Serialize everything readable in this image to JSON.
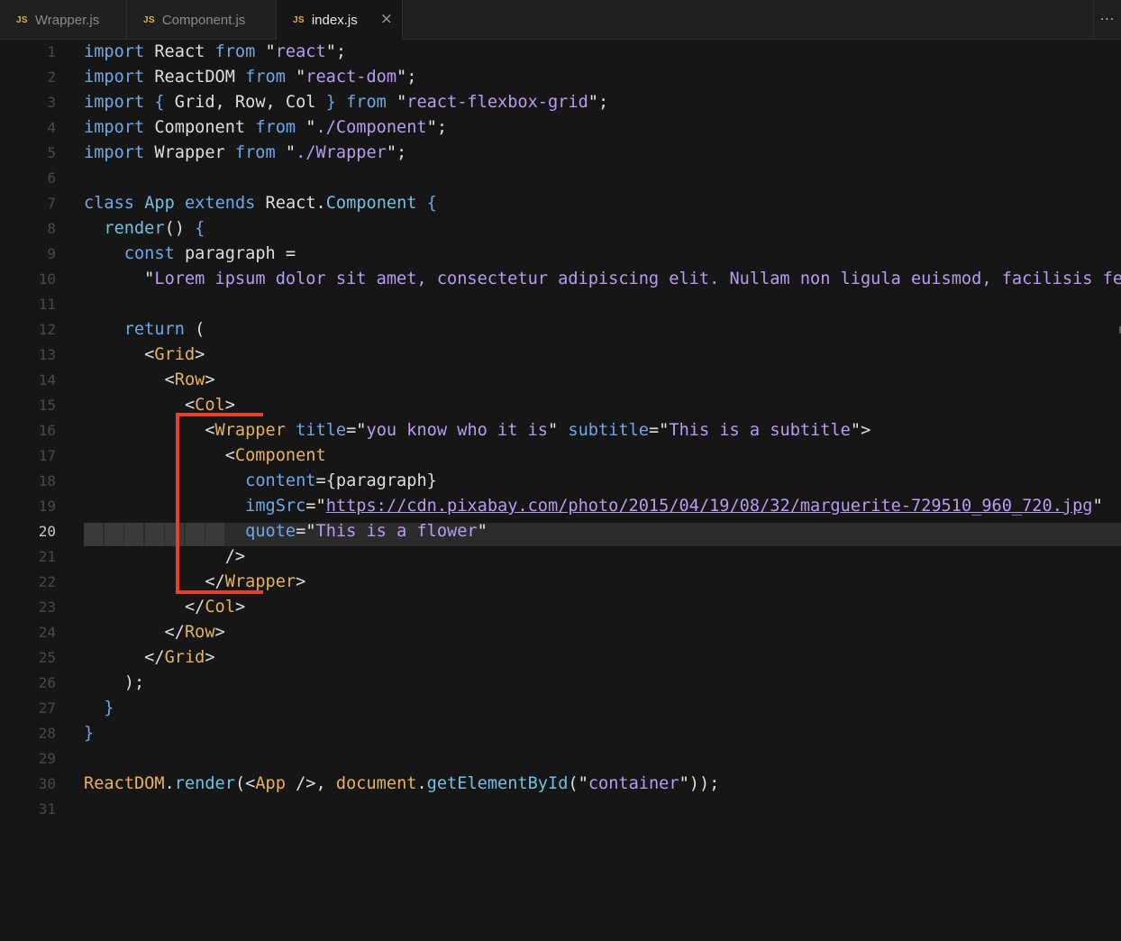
{
  "tabs": [
    {
      "icon": "JS",
      "label": "Wrapper.js"
    },
    {
      "icon": "JS",
      "label": "Component.js"
    },
    {
      "icon": "JS",
      "label": "index.js",
      "close": "×"
    }
  ],
  "more": "···",
  "lines": [
    {
      "n": "1",
      "t": [
        [
          "k",
          "import"
        ],
        [
          "p",
          " React "
        ],
        [
          "k",
          "from"
        ],
        [
          "q",
          " \""
        ],
        [
          "s",
          "react"
        ],
        [
          "q",
          "\""
        ],
        [
          "p",
          ";"
        ]
      ]
    },
    {
      "n": "2",
      "t": [
        [
          "k",
          "import"
        ],
        [
          "p",
          " ReactDOM "
        ],
        [
          "k",
          "from"
        ],
        [
          "q",
          " \""
        ],
        [
          "s",
          "react-dom"
        ],
        [
          "q",
          "\""
        ],
        [
          "p",
          ";"
        ]
      ]
    },
    {
      "n": "3",
      "t": [
        [
          "k",
          "import"
        ],
        [
          "k",
          " { "
        ],
        [
          "p",
          "Grid, Row, Col"
        ],
        [
          "k",
          " } "
        ],
        [
          "k",
          "from"
        ],
        [
          "q",
          " \""
        ],
        [
          "s",
          "react-flexbox-grid"
        ],
        [
          "q",
          "\""
        ],
        [
          "p",
          ";"
        ]
      ]
    },
    {
      "n": "4",
      "t": [
        [
          "k",
          "import"
        ],
        [
          "p",
          " Component "
        ],
        [
          "k",
          "from"
        ],
        [
          "q",
          " \""
        ],
        [
          "s",
          "./Component"
        ],
        [
          "q",
          "\""
        ],
        [
          "p",
          ";"
        ]
      ]
    },
    {
      "n": "5",
      "t": [
        [
          "k",
          "import"
        ],
        [
          "p",
          " Wrapper "
        ],
        [
          "k",
          "from"
        ],
        [
          "q",
          " \""
        ],
        [
          "s",
          "./Wrapper"
        ],
        [
          "q",
          "\""
        ],
        [
          "p",
          ";"
        ]
      ]
    },
    {
      "n": "6",
      "t": []
    },
    {
      "n": "7",
      "t": [
        [
          "k",
          "class"
        ],
        [
          "p",
          " "
        ],
        [
          "f",
          "App"
        ],
        [
          "p",
          " "
        ],
        [
          "k",
          "extends"
        ],
        [
          "p",
          " React."
        ],
        [
          "f",
          "Component"
        ],
        [
          "k",
          " {"
        ]
      ]
    },
    {
      "n": "8",
      "t": [
        [
          "p",
          "  "
        ],
        [
          "f",
          "render"
        ],
        [
          "p",
          "() "
        ],
        [
          "k",
          "{"
        ]
      ]
    },
    {
      "n": "9",
      "t": [
        [
          "p",
          "    "
        ],
        [
          "k",
          "const"
        ],
        [
          "p",
          " paragraph ="
        ]
      ]
    },
    {
      "n": "10",
      "t": [
        [
          "p",
          "      "
        ],
        [
          "q",
          "\""
        ],
        [
          "s",
          "Lorem ipsum dolor sit amet, consectetur adipiscing elit. Nullam non ligula euismod, facilisis fe"
        ]
      ]
    },
    {
      "n": "11",
      "t": []
    },
    {
      "n": "12",
      "t": [
        [
          "p",
          "    "
        ],
        [
          "k",
          "return"
        ],
        [
          "p",
          " ("
        ]
      ]
    },
    {
      "n": "13",
      "t": [
        [
          "p",
          "      <"
        ],
        [
          "t",
          "Grid"
        ],
        [
          "p",
          ">"
        ]
      ]
    },
    {
      "n": "14",
      "t": [
        [
          "p",
          "        <"
        ],
        [
          "t",
          "Row"
        ],
        [
          "p",
          ">"
        ]
      ]
    },
    {
      "n": "15",
      "t": [
        [
          "p",
          "          <"
        ],
        [
          "t",
          "Col"
        ],
        [
          "p",
          ">"
        ]
      ]
    },
    {
      "n": "16",
      "t": [
        [
          "p",
          "            <"
        ],
        [
          "t",
          "Wrapper"
        ],
        [
          "p",
          " "
        ],
        [
          "a",
          "title"
        ],
        [
          "p",
          "="
        ],
        [
          "q",
          "\""
        ],
        [
          "s",
          "you know who it is"
        ],
        [
          "q",
          "\""
        ],
        [
          "p",
          " "
        ],
        [
          "a",
          "subtitle"
        ],
        [
          "p",
          "="
        ],
        [
          "q",
          "\""
        ],
        [
          "s",
          "This is a subtitle"
        ],
        [
          "q",
          "\""
        ],
        [
          "p",
          ">"
        ]
      ]
    },
    {
      "n": "17",
      "t": [
        [
          "p",
          "              <"
        ],
        [
          "t",
          "Component"
        ]
      ]
    },
    {
      "n": "18",
      "t": [
        [
          "p",
          "                "
        ],
        [
          "a",
          "content"
        ],
        [
          "p",
          "={paragraph}"
        ]
      ]
    },
    {
      "n": "19",
      "t": [
        [
          "p",
          "                "
        ],
        [
          "a",
          "imgSrc"
        ],
        [
          "p",
          "="
        ],
        [
          "q",
          "\""
        ],
        [
          "su",
          "https://cdn.pixabay.com/photo/2015/04/19/08/32/marguerite-729510_960_720.jpg"
        ],
        [
          "q",
          "\""
        ]
      ]
    },
    {
      "n": "20",
      "t": [
        [
          "p",
          "                "
        ],
        [
          "a",
          "quote"
        ],
        [
          "p",
          "="
        ],
        [
          "q",
          "\""
        ],
        [
          "s",
          "This is a flower"
        ],
        [
          "q",
          "\""
        ]
      ],
      "current": true
    },
    {
      "n": "21",
      "t": [
        [
          "p",
          "              />"
        ]
      ]
    },
    {
      "n": "22",
      "t": [
        [
          "p",
          "            </"
        ],
        [
          "t",
          "Wrapper"
        ],
        [
          "p",
          ">"
        ]
      ]
    },
    {
      "n": "23",
      "t": [
        [
          "p",
          "          </"
        ],
        [
          "t",
          "Col"
        ],
        [
          "p",
          ">"
        ]
      ]
    },
    {
      "n": "24",
      "t": [
        [
          "p",
          "        </"
        ],
        [
          "t",
          "Row"
        ],
        [
          "p",
          ">"
        ]
      ]
    },
    {
      "n": "25",
      "t": [
        [
          "p",
          "      </"
        ],
        [
          "t",
          "Grid"
        ],
        [
          "p",
          ">"
        ]
      ]
    },
    {
      "n": "26",
      "t": [
        [
          "p",
          "    );"
        ]
      ]
    },
    {
      "n": "27",
      "t": [
        [
          "p",
          "  "
        ],
        [
          "k",
          "}"
        ]
      ]
    },
    {
      "n": "28",
      "t": [
        [
          "k",
          "}"
        ]
      ]
    },
    {
      "n": "29",
      "t": []
    },
    {
      "n": "30",
      "t": [
        [
          "t",
          "ReactDOM"
        ],
        [
          "p",
          "."
        ],
        [
          "f",
          "render"
        ],
        [
          "p",
          "(<"
        ],
        [
          "t",
          "App"
        ],
        [
          "p",
          " />, "
        ],
        [
          "t",
          "document"
        ],
        [
          "p",
          "."
        ],
        [
          "f",
          "getElementById"
        ],
        [
          "p",
          "("
        ],
        [
          "q",
          "\""
        ],
        [
          "s",
          "container"
        ],
        [
          "q",
          "\""
        ],
        [
          "p",
          "));"
        ]
      ]
    },
    {
      "n": "31",
      "t": []
    }
  ],
  "colors": {
    "annotation": "#e8402a",
    "keyword": "#6fa8e8",
    "string": "#b79cf0",
    "tag": "#e7b25e"
  }
}
